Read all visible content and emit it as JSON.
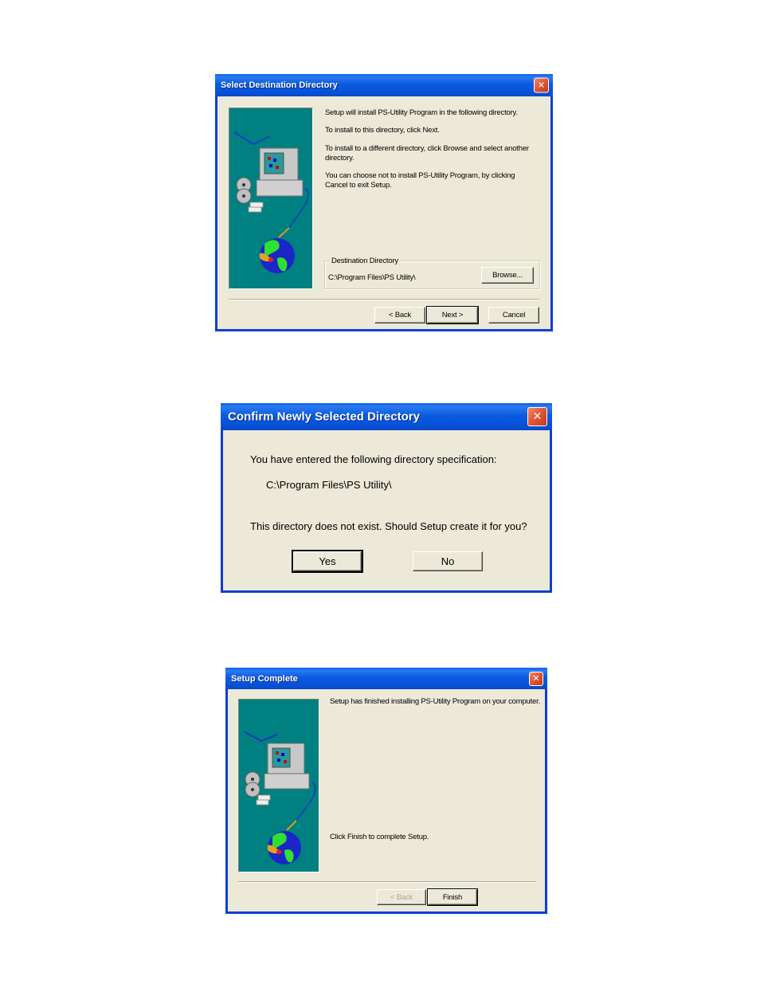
{
  "dialogs": [
    {
      "title": "Select Destination Directory",
      "close_label": "✕",
      "messages": [
        "Setup will install PS-Utility Program in the following directory.",
        "To install to this directory, click Next.",
        "To install to a different directory, click Browse and select another",
        "directory.",
        "You can choose not to install PS-Utility Program, by clicking",
        "Cancel to exit Setup."
      ],
      "group_label": "Destination Directory",
      "directory": "C:\\Program Files\\PS Utility\\",
      "browse_label": "Browse...",
      "back_label": "< Back",
      "next_label": "Next >",
      "cancel_label": "Cancel"
    },
    {
      "title": "Confirm Newly Selected Directory",
      "close_label": "✕",
      "message_1": "You have entered the following directory specification:",
      "directory": "C:\\Program Files\\PS Utility\\",
      "message_2": "This directory does not exist.  Should Setup create it for you?",
      "yes_label": "Yes",
      "no_label": "No"
    },
    {
      "title": "Setup Complete",
      "close_label": "✕",
      "message_1": "Setup has finished installing PS-Utility Program on your computer.",
      "message_2": "Click Finish to complete Setup.",
      "back_label": "< Back",
      "finish_label": "Finish"
    }
  ],
  "colors": {
    "title_bar": "#0a5ce6",
    "window_bg": "#ece9d8",
    "art_bg": "#008080",
    "close_button": "#e05533"
  }
}
